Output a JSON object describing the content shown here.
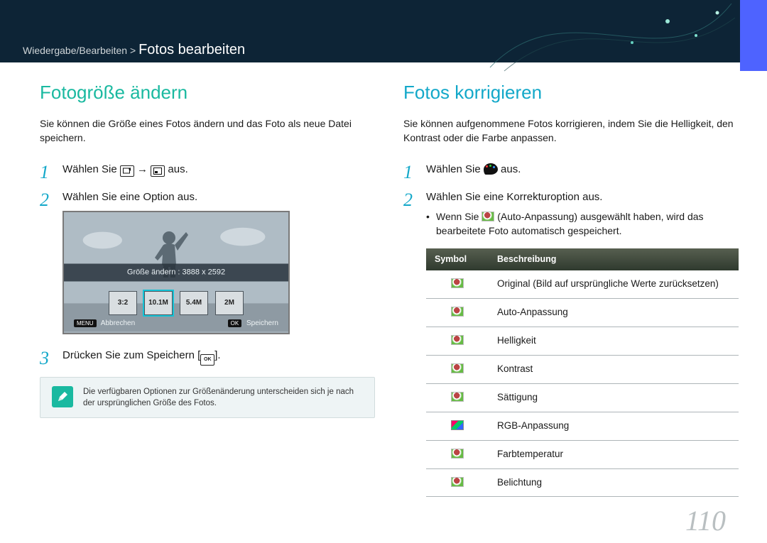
{
  "breadcrumb": {
    "path": "Wiedergabe/Bearbeiten >",
    "title": "Fotos bearbeiten"
  },
  "page_number": "110",
  "left": {
    "heading": "Fotogröße ändern",
    "intro": "Sie können die Größe eines Fotos ändern und das Foto als neue Datei speichern.",
    "step1_a": "Wählen Sie ",
    "step1_b": " → ",
    "step1_c": " aus.",
    "step2": "Wählen Sie eine Option aus.",
    "lcd": {
      "label": "Größe ändern : 3888 x 2592",
      "buttons": [
        "3:2",
        "10.1M",
        "5.4M",
        "2M"
      ],
      "foot_left_key": "MENU",
      "foot_left": "Abbrechen",
      "foot_right_key": "OK",
      "foot_right": "Speichern"
    },
    "step3_a": "Drücken Sie zum Speichern [",
    "step3_b": "].",
    "note": "Die verfügbaren Optionen zur Größenänderung unterscheiden sich je nach der ursprünglichen Größe des Fotos."
  },
  "right": {
    "heading": "Fotos korrigieren",
    "intro": "Sie können aufgenommene Fotos korrigieren, indem Sie die Helligkeit, den Kontrast oder die Farbe anpassen.",
    "step1_a": "Wählen Sie ",
    "step1_b": " aus.",
    "step2": "Wählen Sie eine Korrekturoption aus.",
    "bullet_a": "Wenn Sie ",
    "bullet_b": " (Auto-Anpassung) ausgewählt haben, wird das bearbeitete Foto automatisch gespeichert.",
    "table": {
      "head_symbol": "Symbol",
      "head_desc": "Beschreibung",
      "rows": [
        "Original (Bild auf ursprüngliche Werte zurücksetzen)",
        "Auto-Anpassung",
        "Helligkeit",
        "Kontrast",
        "Sättigung",
        "RGB-Anpassung",
        "Farbtemperatur",
        "Belichtung"
      ]
    }
  }
}
